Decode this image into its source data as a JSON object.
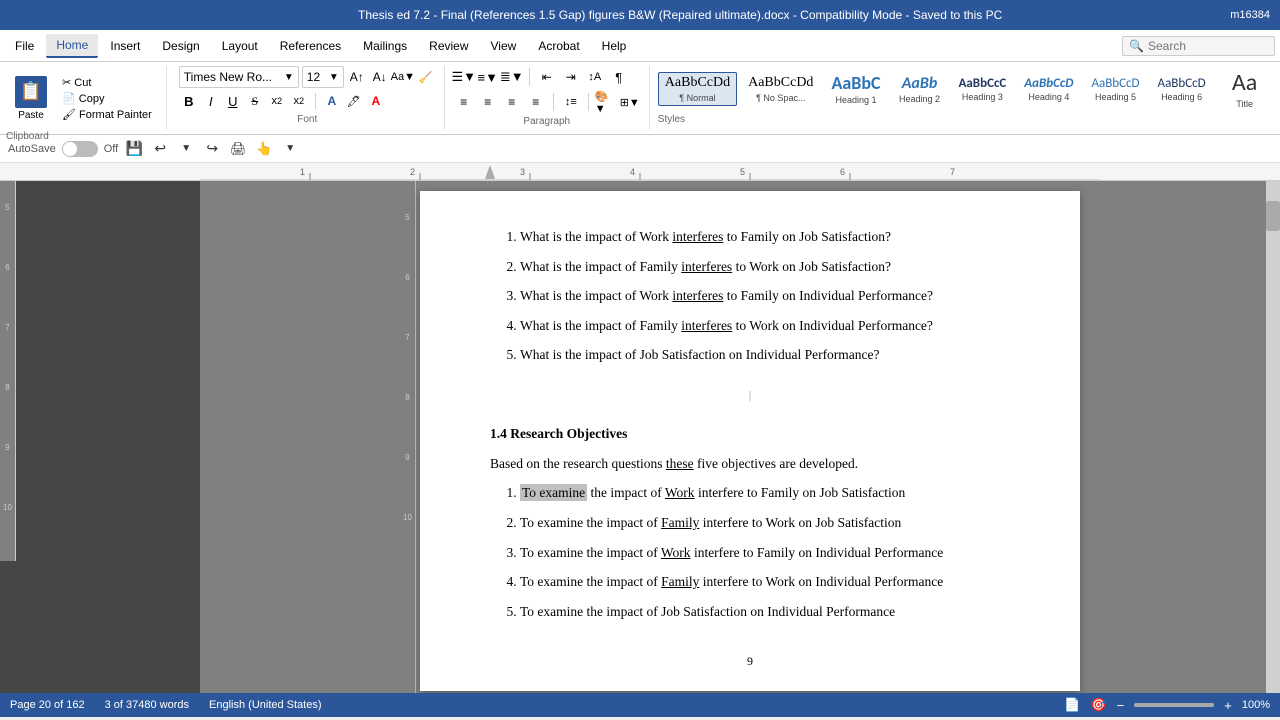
{
  "titlebar": {
    "text": "Thesis ed 7.2 - Final (References 1.5 Gap) figures B&W (Repaired ultimate).docx  -  Compatibility Mode  -  Saved to this PC",
    "win_id": "m16384"
  },
  "menubar": {
    "items": [
      "File",
      "Home",
      "Insert",
      "Design",
      "Layout",
      "References",
      "Mailings",
      "Review",
      "View",
      "Acrobat",
      "Help"
    ],
    "active": "Home",
    "search_placeholder": "Search"
  },
  "ribbon": {
    "clipboard": {
      "paste_label": "Paste",
      "cut_label": "Cut",
      "copy_label": "Copy",
      "format_painter_label": "Format Painter"
    },
    "font": {
      "font_name": "Times New Ro...",
      "font_size": "12",
      "bold": "B",
      "italic": "I",
      "underline": "U",
      "strikethrough": "S",
      "subscript": "x₂",
      "superscript": "x²",
      "label": "Font"
    },
    "paragraph": {
      "label": "Paragraph"
    },
    "styles": {
      "label": "Styles",
      "items": [
        {
          "name": "Normal",
          "preview": "AaBbCcDd",
          "active": true
        },
        {
          "name": "No Spac...",
          "preview": "AaBbCcDd"
        },
        {
          "name": "Heading 1",
          "preview": "AaBbC"
        },
        {
          "name": "Heading 2",
          "preview": "AaBb"
        },
        {
          "name": "Heading 3",
          "preview": "AaBbCcC"
        },
        {
          "name": "Heading 4",
          "preview": "AaBbCcD"
        },
        {
          "name": "Heading 5",
          "preview": "AaBbCcD"
        },
        {
          "name": "Heading 6",
          "preview": "AaBbCcD"
        },
        {
          "name": "Title",
          "preview": "Aa"
        }
      ]
    }
  },
  "autosave": {
    "label": "AutoSave",
    "state": "Off"
  },
  "document": {
    "questions": [
      "What is the impact of Work interferes to Family on Job Satisfaction?",
      "What is the impact of Family interferes to Work on Job Satisfaction?",
      "What is the impact of Work interferes to Family on Individual Performance?",
      "What is the impact of Family interferes to Work on Individual Performance?",
      "What is the impact of Job Satisfaction on Individual Performance?"
    ],
    "section_heading": "1.4 Research Objectives",
    "intro_text": "Based on the research questions these five objectives are developed.",
    "objectives": [
      "To examine the impact of Work interfere to Family on Job Satisfaction",
      "To examine the impact of Family interfere to Work on Job Satisfaction",
      "To examine the impact of Work interfere to Family on Individual Performance",
      "To examine the impact of Family interfere to Work on Individual Performance",
      "To examine the impact of Job Satisfaction on Individual Performance"
    ],
    "page_number": "9",
    "underline_words_q": [
      "interferes",
      "interferes",
      "interferes",
      "interferes"
    ],
    "underline_words_obj": [
      "Work",
      "Family",
      "Work",
      "Family"
    ]
  },
  "statusbar": {
    "page_info": "Page 20 of 162",
    "word_count": "3 of 37480 words",
    "language": "English (United States)"
  }
}
